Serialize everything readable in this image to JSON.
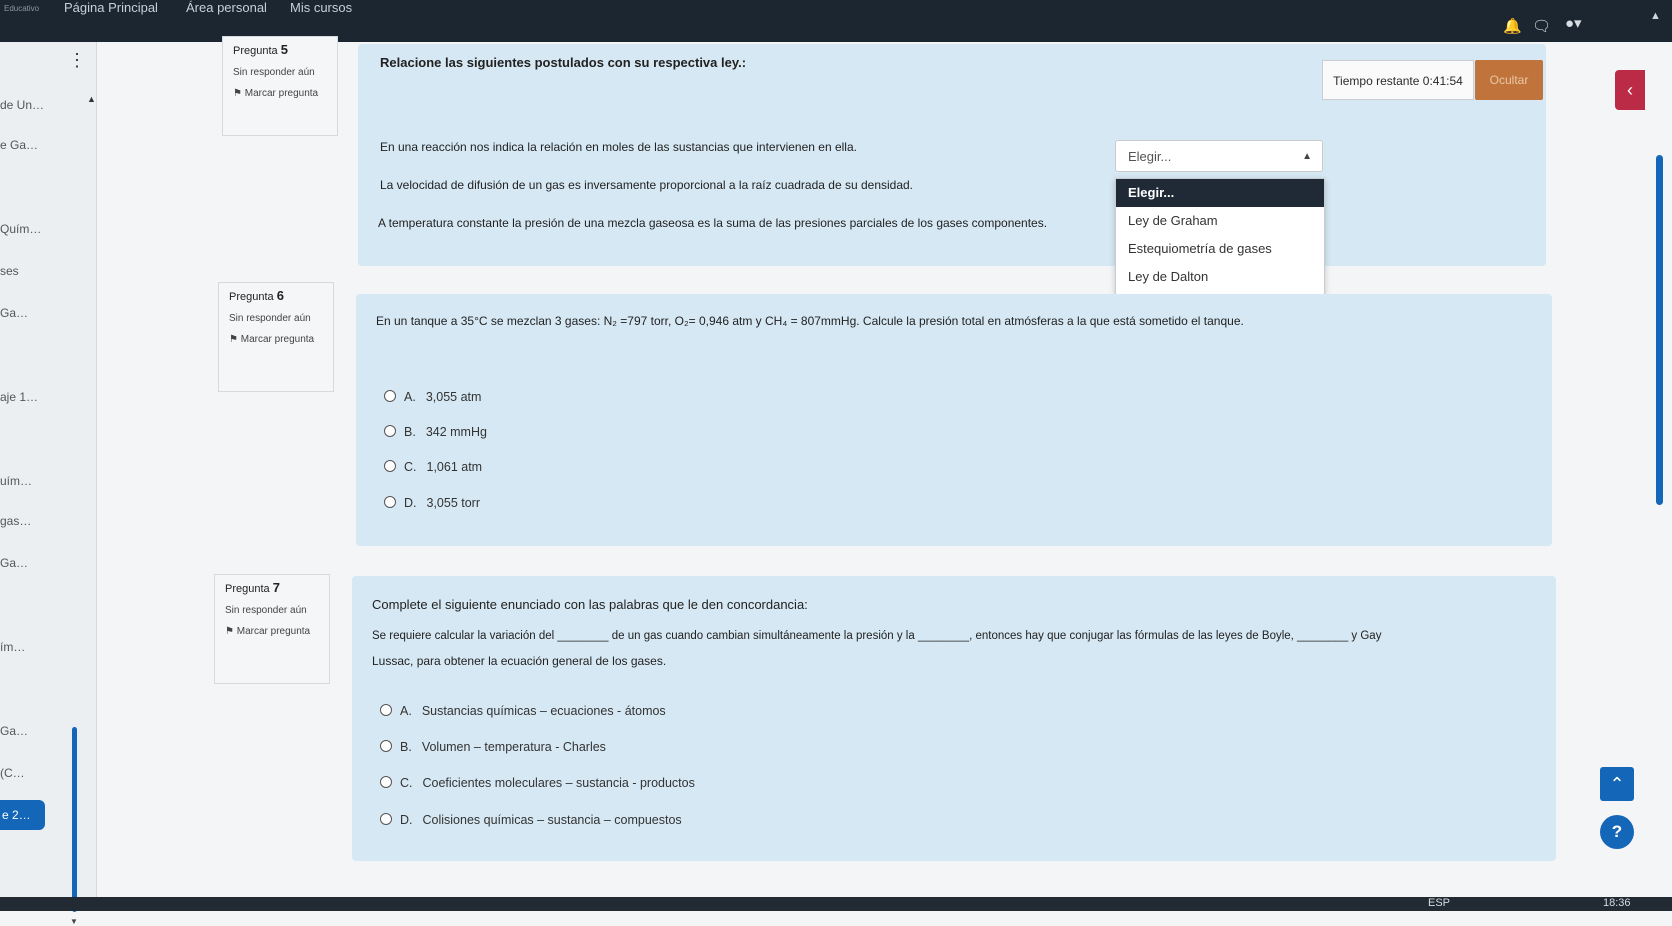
{
  "topbar": {
    "logo": "Educativo",
    "nav": [
      "Página Principal",
      "Área personal",
      "Mis cursos"
    ]
  },
  "leftnav": {
    "items": [
      "de Un…",
      "e Ga…",
      "Quím…",
      "ses",
      "Ga…",
      "aje 1…",
      "uím…",
      "gas…",
      "Ga…",
      "ím…",
      "Ga…",
      "(C…",
      "e 2…"
    ]
  },
  "timer": {
    "label": "Tiempo restante 0:41:54",
    "hide_label": "Ocultar"
  },
  "questions": [
    {
      "number_label": "Pregunta",
      "number": "5",
      "state": "Sin responder aún",
      "flag_label": "Marcar pregunta",
      "title": "Relacione las siguientes postulados con su respectiva ley.:",
      "statements": [
        "En una reacción nos indica la relación en moles de las sustancias que intervienen en ella.",
        "La velocidad de difusión de un gas es inversamente proporcional a la raíz cuadrada de su densidad.",
        "A temperatura constante la presión de una mezcla gaseosa es la suma de las presiones parciales de los gases componentes."
      ],
      "select": {
        "value": "Elegir...",
        "options": [
          "Elegir...",
          "Ley de Graham",
          "Estequiometría de gases",
          "Ley de Dalton"
        ]
      }
    },
    {
      "number_label": "Pregunta",
      "number": "6",
      "state": "Sin responder aún",
      "flag_label": "Marcar pregunta",
      "text": "En un tanque a 35°C se mezclan 3 gases:  N₂ =797 torr, O₂= 0,946 atm y CH₄ = 807mmHg. Calcule la presión total en atmósferas a la que está sometido el tanque.",
      "options": [
        {
          "letter": "A.",
          "text": "3,055 atm"
        },
        {
          "letter": "B.",
          "text": "342 mmHg"
        },
        {
          "letter": "C.",
          "text": "1,061 atm"
        },
        {
          "letter": "D.",
          "text": "3,055 torr"
        }
      ]
    },
    {
      "number_label": "Pregunta",
      "number": "7",
      "state": "Sin responder aún",
      "flag_label": "Marcar pregunta",
      "title": "Complete el siguiente enunciado con las palabras que le den concordancia:",
      "text_line1": "Se requiere calcular la variación del ________ de un gas cuando cambian simultáneamente la presión y la ________, entonces hay que conjugar las fórmulas de las leyes de Boyle, ________ y Gay",
      "text_line2": "Lussac, para obtener la ecuación general de los gases.",
      "options": [
        {
          "letter": "A.",
          "text": "Sustancias químicas – ecuaciones - átomos"
        },
        {
          "letter": "B.",
          "text": "Volumen – temperatura - Charles"
        },
        {
          "letter": "C.",
          "text": "Coeficientes moleculares – sustancia - productos"
        },
        {
          "letter": "D.",
          "text": "Colisiones químicas – sustancia – compuestos"
        }
      ]
    }
  ],
  "taskbar": {
    "lang": "ESP",
    "clock": "18:36"
  },
  "colors": {
    "accent": "#1466b8",
    "card": "#d6e8f3",
    "hide_button": "#c0733b",
    "drawer_button": "#bb2b45"
  }
}
